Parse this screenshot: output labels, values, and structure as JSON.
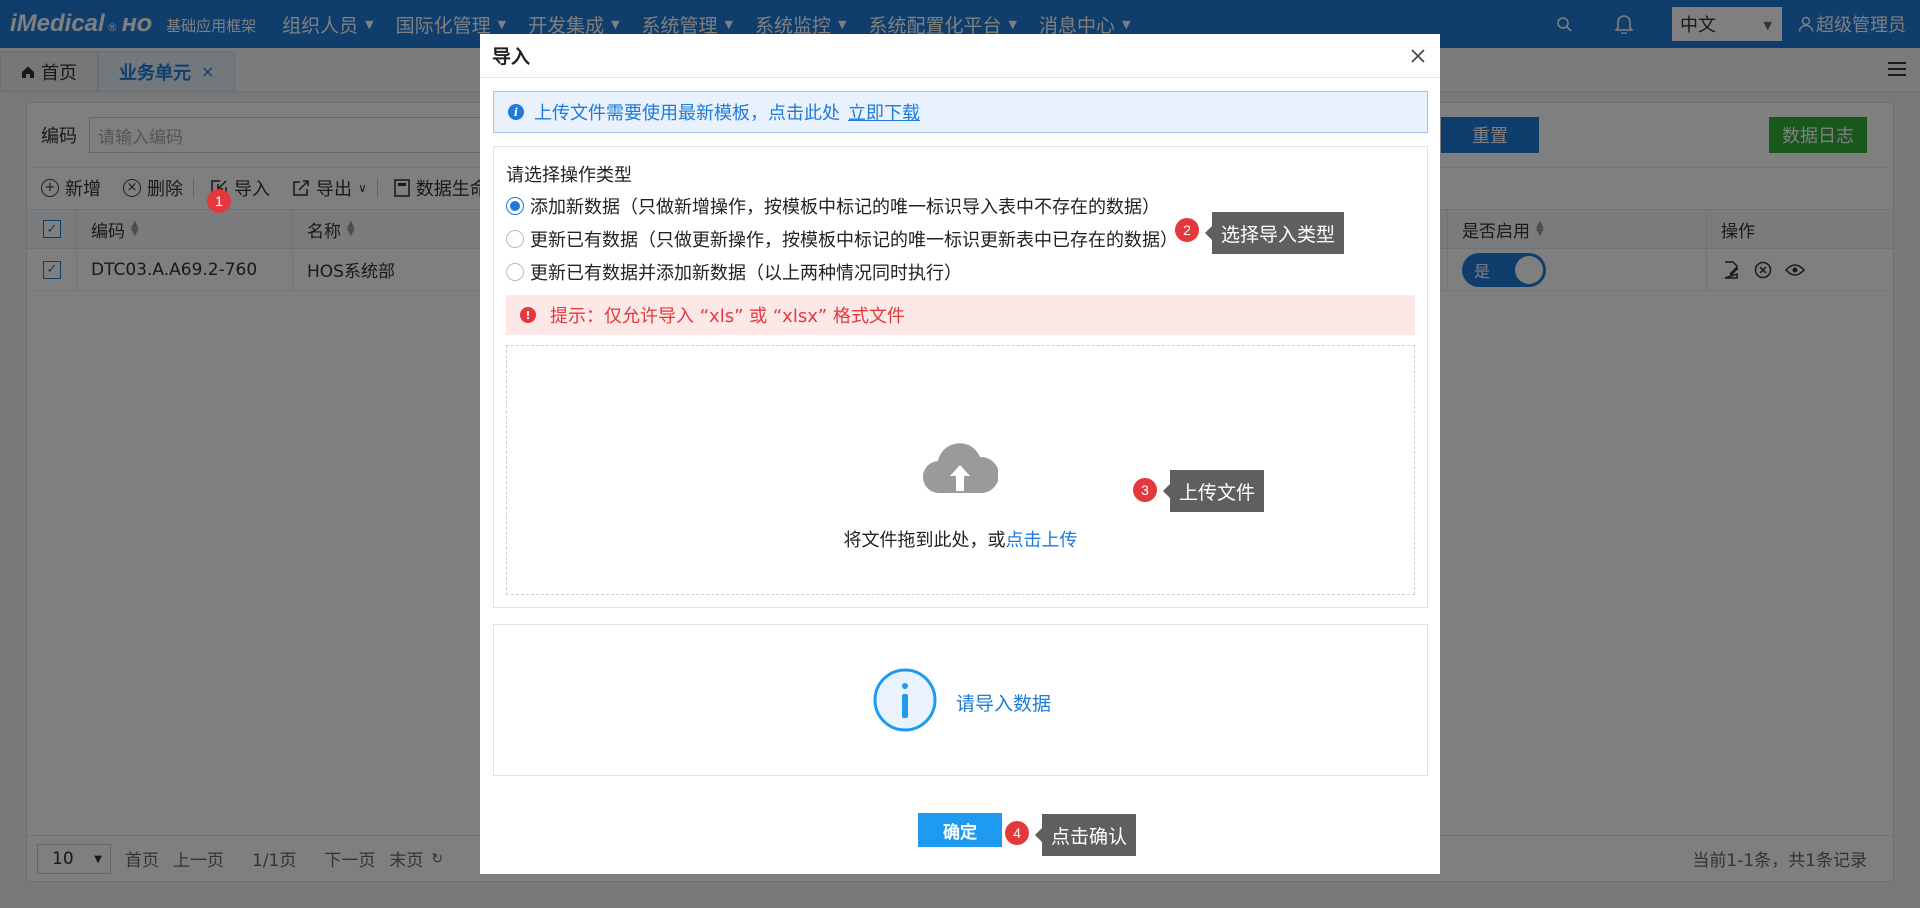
{
  "topbar": {
    "brand": "iMedical",
    "brand_reg": "®",
    "brand_suffix": "HO",
    "brand_sub": "基础应用框架",
    "nav": [
      "组织人员",
      "国际化管理",
      "开发集成",
      "系统管理",
      "系统监控",
      "系统配置化平台",
      "消息中心"
    ],
    "language": "中文",
    "user": "超级管理员"
  },
  "tabs": {
    "home": "首页",
    "active": "业务单元",
    "close": "×"
  },
  "search": {
    "label": "编码",
    "placeholder": "请输入编码",
    "reset_label": "重置",
    "log_label": "数据日志"
  },
  "toolbar": {
    "add": "新增",
    "delete": "删除",
    "import": "导入",
    "export": "导出",
    "generate": "数据生命"
  },
  "grid": {
    "headers": {
      "code": "编码",
      "name": "名称",
      "enabled": "是否启用",
      "ops": "操作"
    },
    "rows": [
      {
        "code": "DTC03.A.A69.2-760",
        "name": "HOS系统部",
        "enabled": "是"
      }
    ]
  },
  "pager": {
    "page_size": "10",
    "first": "首页",
    "prev": "上一页",
    "page": "1/1页",
    "next": "下一页",
    "last": "末页",
    "info": "当前1-1条，共1条记录"
  },
  "modal": {
    "title": "导入",
    "notice_text": "上传文件需要使用最新模板，点击此处",
    "notice_link": "立即下载",
    "section_title": "请选择操作类型",
    "options": [
      "添加新数据（只做新增操作，按模板中标记的唯一标识导入表中不存在的数据）",
      "更新已有数据（只做更新操作，按模板中标记的唯一标识更新表中已存在的数据）",
      "更新已有数据并添加新数据（以上两种情况同时执行）"
    ],
    "selected_option": 0,
    "warning": "提示：仅允许导入 “xls” 或 “xlsx” 格式文件",
    "drop_text": "将文件拖到此处，或",
    "drop_link": "点击上传",
    "result_text": "请导入数据",
    "ok_label": "确定"
  },
  "annotations": [
    {
      "number": "1",
      "label": ""
    },
    {
      "number": "2",
      "label": "选择导入类型"
    },
    {
      "number": "3",
      "label": "上传文件"
    },
    {
      "number": "4",
      "label": "点击确认"
    }
  ],
  "colors": {
    "primary": "#1e7bd9",
    "success": "#30b03a",
    "danger": "#e4393c",
    "tooltip": "#5f5f5f"
  }
}
